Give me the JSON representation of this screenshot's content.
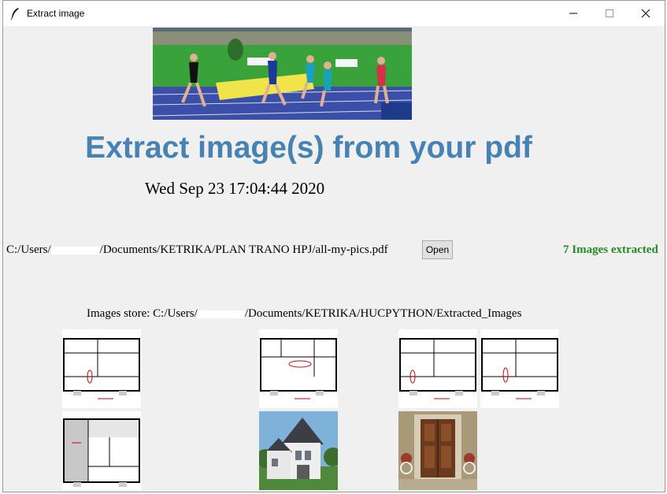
{
  "window": {
    "title": "Extract image",
    "controls": {
      "minimize": "minimize-icon",
      "maximize": "maximize-icon",
      "close": "close-icon"
    }
  },
  "headline": "Extract image(s) from your pdf",
  "datetime": "Wed Sep 23 17:04:44 2020",
  "file": {
    "path_prefix": "C:/Users/",
    "path_suffix": "/Documents/KETRIKA/PLAN TRANO HPJ/all-my-pics.pdf",
    "open_label": "Open"
  },
  "status": "7 Images extracted",
  "store": {
    "prefix": "Images store: C:/Users/",
    "suffix": "/Documents/KETRIKA/HUCPYTHON/Extracted_Images"
  },
  "thumbnails": [
    {
      "kind": "floor-plan"
    },
    {
      "kind": "floor-plan"
    },
    {
      "kind": "floor-plan"
    },
    {
      "kind": "floor-plan"
    },
    {
      "kind": "floor-plan"
    },
    {
      "kind": "house-photo"
    },
    {
      "kind": "door-photo"
    }
  ],
  "colors": {
    "headline": "#4682b4",
    "status": "#228b22",
    "window_bg": "#f0f0f0"
  }
}
